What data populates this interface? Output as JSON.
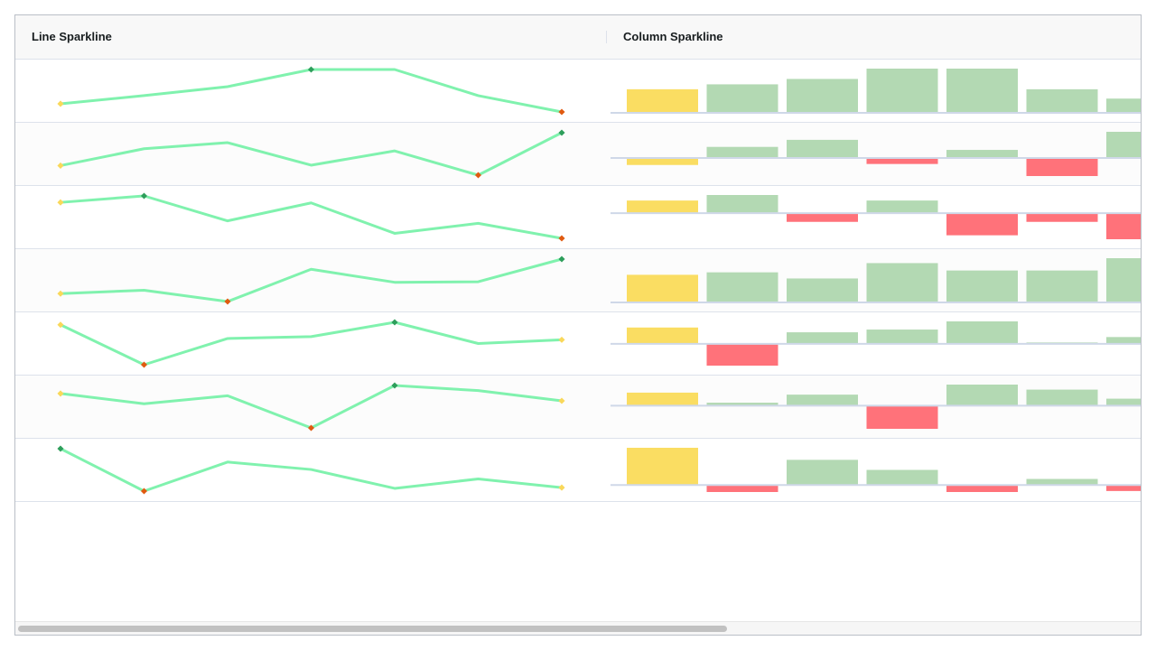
{
  "grid": {
    "columns": {
      "line": "Line Sparkline",
      "column": "Column Sparkline"
    }
  },
  "colors": {
    "line": "#80f2ae",
    "marker_first": "#f9d85a",
    "marker_max": "#2e9e5b",
    "marker_min": "#e05a10",
    "column_first": "#fadd62",
    "column_positive": "#b3d9b3",
    "column_negative": "#ff727a",
    "axis": "#cfd8e8",
    "header_bg": "#f8f8f8",
    "row_alt_bg": "#fcfcfc"
  },
  "chart_data": [
    {
      "type": "line",
      "name": "",
      "rows": [
        [
          4.8,
          5.8,
          6.9,
          9.0,
          9.0,
          5.8,
          3.8
        ],
        [
          3.9,
          7.8,
          9.2,
          4.0,
          7.3,
          1.7,
          11.5
        ],
        [
          6.0,
          7.3,
          2.3,
          5.9,
          -0.2,
          1.8,
          -1.2
        ],
        [
          4.5,
          5.1,
          3.1,
          8.8,
          6.5,
          6.6,
          10.6
        ],
        [
          3.8,
          -2.6,
          1.6,
          1.9,
          4.2,
          0.8,
          1.4
        ],
        [
          2.2,
          0.8,
          1.9,
          -2.5,
          3.3,
          2.6,
          1.2
        ],
        [
          8.9,
          -1.9,
          5.5,
          3.6,
          -1.2,
          1.2,
          -1.0
        ]
      ]
    },
    {
      "type": "bar",
      "name": "",
      "rows": [
        [
          4.8,
          5.8,
          6.9,
          9.0,
          9.0,
          4.8,
          2.9
        ],
        [
          -0.7,
          1.1,
          1.8,
          -0.6,
          0.8,
          -1.8,
          2.6
        ],
        [
          1.6,
          2.3,
          -1.1,
          1.6,
          -2.8,
          -1.1,
          -3.3
        ],
        [
          4.5,
          4.9,
          3.9,
          6.4,
          5.2,
          5.2,
          7.2
        ],
        [
          2.4,
          -3.2,
          1.7,
          2.1,
          3.3,
          0.2,
          1.0
        ],
        [
          1.3,
          0.3,
          1.1,
          -2.3,
          2.1,
          1.6,
          0.7
        ],
        [
          3.7,
          -0.7,
          2.5,
          1.5,
          -0.7,
          0.6,
          -0.6
        ]
      ]
    }
  ]
}
